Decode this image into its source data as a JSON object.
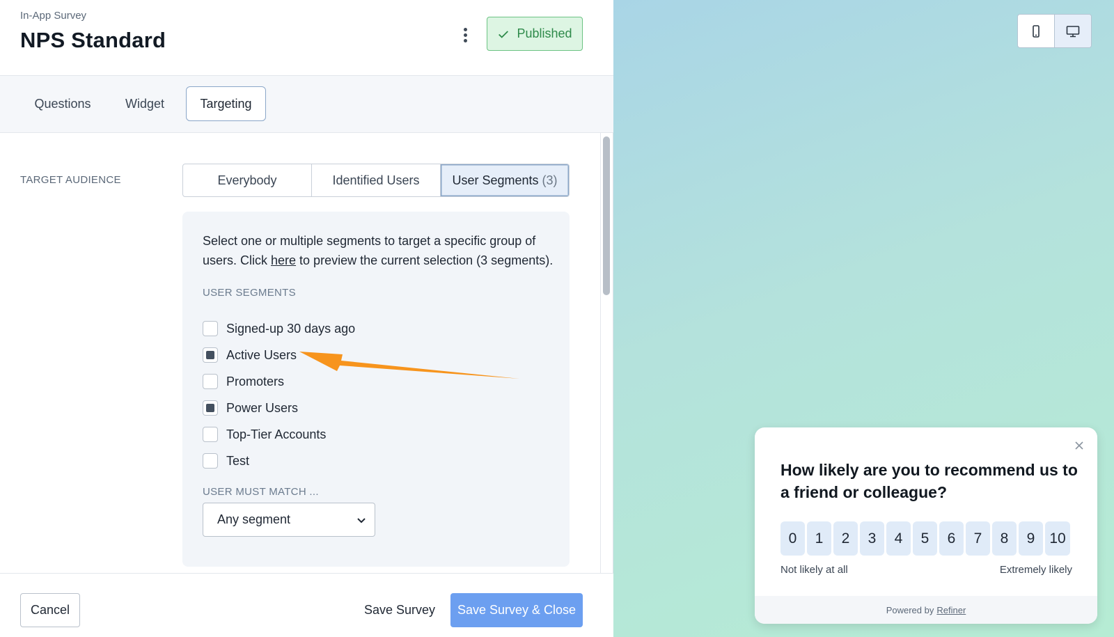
{
  "header": {
    "subtitle": "In-App Survey",
    "title": "NPS Standard",
    "status_label": "Published"
  },
  "tabs": [
    {
      "label": "Questions"
    },
    {
      "label": "Widget"
    },
    {
      "label": "Targeting",
      "active": true
    }
  ],
  "targeting": {
    "audience_label": "TARGET AUDIENCE",
    "audience_options": [
      {
        "label": "Everybody"
      },
      {
        "label": "Identified Users"
      },
      {
        "label": "User Segments",
        "count": "(3)",
        "selected": true
      }
    ],
    "description_part1": "Select one or multiple segments to target a specific group of users. Click ",
    "description_link": "here",
    "description_part2": " to preview the current selection (3 segments).",
    "segments_label": "USER SEGMENTS",
    "segments": [
      {
        "label": "Signed-up 30 days ago",
        "checked": false
      },
      {
        "label": "Active Users",
        "checked": true
      },
      {
        "label": "Promoters",
        "checked": false
      },
      {
        "label": "Power Users",
        "checked": true
      },
      {
        "label": "Top-Tier Accounts",
        "checked": false
      },
      {
        "label": "Test",
        "checked": false
      }
    ],
    "match_label": "USER MUST MATCH ...",
    "match_value": "Any segment"
  },
  "footer": {
    "cancel_label": "Cancel",
    "save_label": "Save Survey",
    "save_close_label": "Save Survey & Close"
  },
  "preview": {
    "device_options": [
      "mobile-icon",
      "desktop-icon"
    ],
    "active_device": "desktop",
    "question": "How likely are you to recommend us to a friend or colleague?",
    "scale": [
      "0",
      "1",
      "2",
      "3",
      "4",
      "5",
      "6",
      "7",
      "8",
      "9",
      "10"
    ],
    "label_low": "Not likely at all",
    "label_high": "Extremely likely",
    "powered_by": "Powered by",
    "powered_link": "Refiner"
  },
  "colors": {
    "accent": "#6c9ff0",
    "published_bg": "#ddf5e3",
    "published_text": "#2e8a4a",
    "annotation_arrow": "#f7941d"
  }
}
